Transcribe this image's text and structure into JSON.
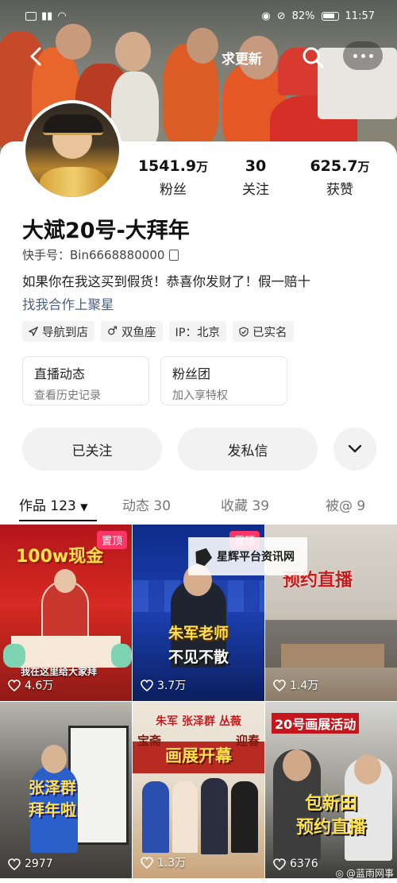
{
  "status_bar": {
    "battery": "82%",
    "time": "11:57"
  },
  "header": {
    "update_label": "求更新"
  },
  "profile": {
    "followers": {
      "value": "1541.9",
      "unit": "万",
      "label": "粉丝"
    },
    "following": {
      "value": "30",
      "unit": "",
      "label": "关注"
    },
    "likes": {
      "value": "625.7",
      "unit": "万",
      "label": "获赞"
    },
    "name": "大斌20号-大拜年",
    "kuaishou_id": "快手号：Bin6668880000",
    "bio_line1": "如果你在我这买到假货！恭喜你发财了！假一赔十",
    "bio_line2": "找我合作上聚星",
    "tags": [
      {
        "icon": "navigation-icon",
        "label": "导航到店"
      },
      {
        "icon": "male-icon",
        "label": "双鱼座"
      },
      {
        "icon": "none",
        "label": "IP：北京"
      },
      {
        "icon": "verified-icon",
        "label": "已实名"
      }
    ],
    "features": [
      {
        "title": "直播动态",
        "sub": "查看历史记录"
      },
      {
        "title": "粉丝团",
        "sub": "加入享特权"
      }
    ],
    "actions": {
      "followed": "已关注",
      "message": "发私信"
    }
  },
  "tabs": [
    {
      "label": "作品 123"
    },
    {
      "label": "动态 30"
    },
    {
      "label": "收藏 39"
    },
    {
      "label": "被@ 9"
    }
  ],
  "videos": [
    {
      "title": "100w现金",
      "pinned": "置顶",
      "caption": "我在这里给大家拜",
      "likes": "4.6万"
    },
    {
      "title": "朱军老师",
      "subtitle": "不见不散",
      "pinned": "置顶",
      "likes": "3.7万"
    },
    {
      "title": "预约直播",
      "likes": "1.4万"
    },
    {
      "title": "张泽群",
      "subtitle": "拜年啦",
      "likes": "2977"
    },
    {
      "title": "朱军 张泽群 丛薇",
      "subtitle": "画展开幕",
      "banner": "宝斋",
      "banner2": "迎春",
      "likes": "1.3万"
    },
    {
      "title": "20号画展活动",
      "subtitle": "包新田",
      "subtitle2": "预约直播",
      "likes": "6376"
    }
  ],
  "watermark": {
    "text": "星辉平台资讯网"
  },
  "credit": {
    "text": "@蓝雨网事"
  },
  "colors": {
    "accent": "#fe3666",
    "link": "#4a5f86",
    "gold_text": "#ffe14a"
  }
}
